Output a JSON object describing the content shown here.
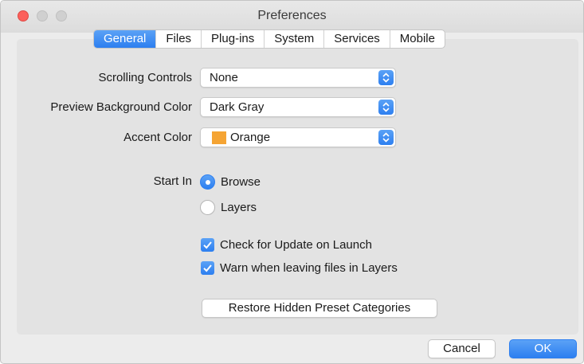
{
  "window": {
    "title": "Preferences"
  },
  "tabs": [
    {
      "label": "General",
      "active": true
    },
    {
      "label": "Files",
      "active": false
    },
    {
      "label": "Plug-ins",
      "active": false
    },
    {
      "label": "System",
      "active": false
    },
    {
      "label": "Services",
      "active": false
    },
    {
      "label": "Mobile",
      "active": false
    }
  ],
  "settings": {
    "scrolling_controls": {
      "label": "Scrolling Controls",
      "value": "None"
    },
    "preview_background": {
      "label": "Preview Background Color",
      "value": "Dark Gray"
    },
    "accent_color": {
      "label": "Accent Color",
      "value": "Orange",
      "swatch": "#f5a433"
    }
  },
  "start_in": {
    "label": "Start In",
    "options": [
      {
        "label": "Browse",
        "selected": true
      },
      {
        "label": "Layers",
        "selected": false
      }
    ]
  },
  "checkboxes": [
    {
      "label": "Check for Update on Launch",
      "checked": true
    },
    {
      "label": "Warn when leaving files in Layers",
      "checked": true
    }
  ],
  "restore_button": {
    "label": "Restore Hidden Preset Categories"
  },
  "footer": {
    "cancel_label": "Cancel",
    "ok_label": "OK"
  },
  "colors": {
    "accent": "#2d7ff0",
    "close": "#fc605b",
    "panel": "#e3e3e3"
  }
}
